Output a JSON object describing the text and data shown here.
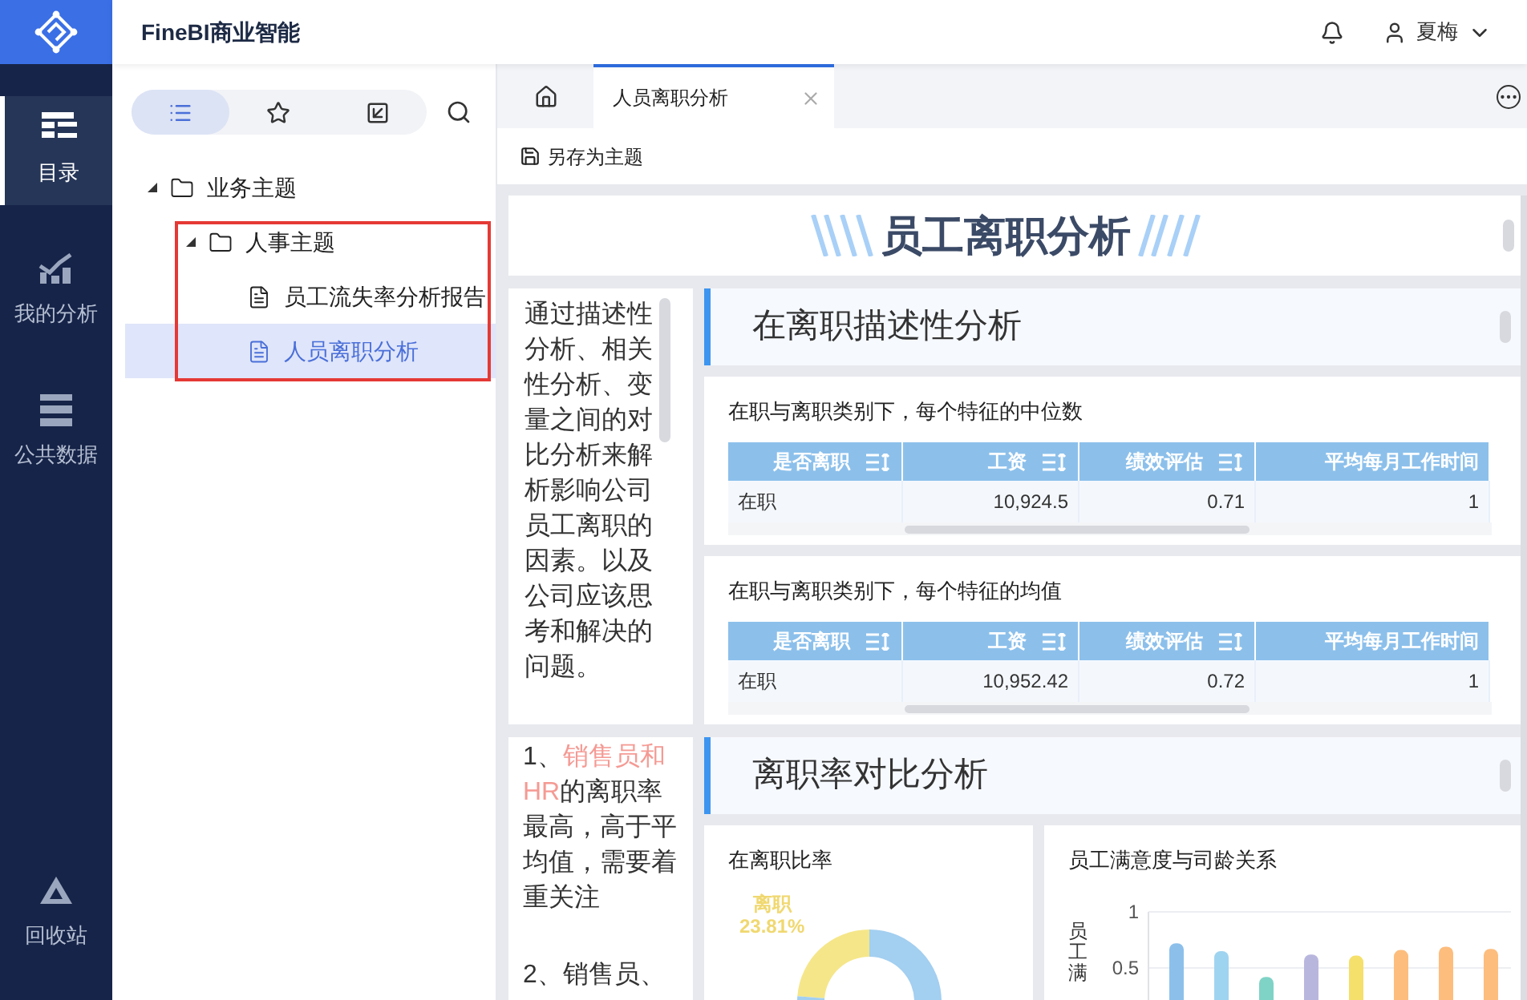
{
  "app": {
    "title": "FineBI商业智能",
    "user": "夏梅"
  },
  "nav": [
    {
      "label": "目录",
      "kind": "catalog",
      "selected": true
    },
    {
      "label": "我的分析",
      "kind": "analysis",
      "selected": false
    },
    {
      "label": "公共数据",
      "kind": "data",
      "selected": false
    },
    {
      "label": "回收站",
      "kind": "trash",
      "selected": false
    }
  ],
  "catalog_tabs": [
    {
      "kind": "list",
      "selected": true
    },
    {
      "kind": "star",
      "selected": false
    },
    {
      "kind": "export",
      "selected": false
    }
  ],
  "tree": [
    {
      "label": "业务主题",
      "kind": "folder",
      "expanded": true,
      "selected": false,
      "highlighted": false,
      "children": [
        {
          "label": "人事主题",
          "kind": "folder",
          "expanded": true,
          "selected": false,
          "highlighted": true,
          "children": [
            {
              "label": "员工流失率分析报告",
              "kind": "report",
              "selected": false,
              "highlighted": false
            },
            {
              "label": "人员离职分析",
              "kind": "report",
              "selected": true,
              "highlighted": false
            }
          ]
        }
      ]
    }
  ],
  "tabs": [
    {
      "kind": "home",
      "selected": false
    },
    {
      "kind": "page",
      "label": "人员离职分析",
      "selected": true
    }
  ],
  "toolbar": {
    "save_as": "另存为主题"
  },
  "dashboard": {
    "title": "员工离职分析",
    "intro": "通过描述性分析、相关性分析、变量之间的对比分析来解析影响公司员工离职的因素。以及公司应该思考和解决的问题。",
    "section1": "在离职描述性分析",
    "tables": [
      {
        "title": "在职与离职类别下，每个特征的中位数",
        "columns": [
          "是否离职",
          "工资",
          "绩效评估",
          "平均每月工作时间"
        ],
        "rows": [
          [
            "在职",
            "10,924.5",
            "0.71",
            "1"
          ]
        ]
      },
      {
        "title": "在职与离职类别下，每个特征的均值",
        "columns": [
          "是否离职",
          "工资",
          "绩效评估",
          "平均每月工作时间"
        ],
        "rows": [
          [
            "在职",
            "10,952.42",
            "0.72",
            "1"
          ]
        ]
      }
    ],
    "notes": [
      [
        {
          "text": "1、",
          "highlight": false
        },
        {
          "text": "销售员和HR",
          "highlight": true
        },
        {
          "text": "的离职率最高，高于平均值，需要着重关注",
          "highlight": false
        }
      ],
      [
        {
          "text": "2、销售员、",
          "highlight": false
        }
      ]
    ],
    "section2": "离职率对比分析",
    "donut": {
      "title": "在离职比率",
      "chart_data": {
        "type": "donut",
        "categories": [
          "离职",
          null
        ],
        "series": [
          {
            "values": [
              23.81,
              76.19
            ]
          }
        ],
        "value_labels": [
          "23.81%",
          null
        ],
        "colors": [
          "#f5e68a",
          "#a3cff0"
        ]
      }
    },
    "bar": {
      "title": "员工满意度与司龄关系",
      "chart_data": {
        "type": "bar",
        "ylabel": "员工满",
        "yticks": [
          0.5,
          1
        ],
        "ylim": [
          0,
          1
        ],
        "series": [
          {
            "values": [
              0.72,
              0.65,
              0.42,
              0.62,
              0.61,
              0.66,
              0.69,
              0.67
            ]
          }
        ],
        "colors": [
          "#8cc0eb",
          "#9fd4f0",
          "#7fd3c6",
          "#b9b6de",
          "#f5e06b",
          "#fdbd7d",
          "#fdbd7d",
          "#fdbd7d"
        ]
      }
    }
  }
}
